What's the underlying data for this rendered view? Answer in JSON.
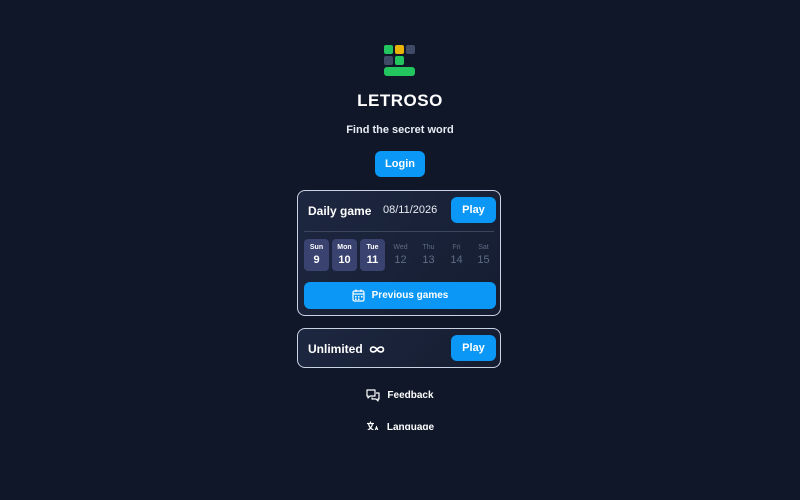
{
  "app": {
    "title": "LETROSO",
    "subtitle": "Find the secret word",
    "colors": {
      "background": "#0f1729",
      "accent": "#0a97f5",
      "green": "#22c55e",
      "yellow": "#eab308"
    }
  },
  "header": {
    "login_label": "Login",
    "logo_icon": "letroso-logo-icon"
  },
  "daily": {
    "label": "Daily game",
    "date": "08/11/2026",
    "play_label": "Play",
    "days": [
      {
        "name": "Sun",
        "num": "9",
        "state": "active"
      },
      {
        "name": "Mon",
        "num": "10",
        "state": "active"
      },
      {
        "name": "Tue",
        "num": "11",
        "state": "active"
      },
      {
        "name": "Wed",
        "num": "12",
        "state": "future"
      },
      {
        "name": "Thu",
        "num": "13",
        "state": "future"
      },
      {
        "name": "Fri",
        "num": "14",
        "state": "future"
      },
      {
        "name": "Sat",
        "num": "15",
        "state": "future"
      }
    ],
    "previous_label": "Previous games",
    "previous_icon": "calendar-icon"
  },
  "unlimited": {
    "label": "Unlimited",
    "icon": "infinity-icon",
    "play_label": "Play"
  },
  "links": {
    "feedback": {
      "label": "Feedback",
      "icon": "chat-bubbles-icon"
    },
    "language": {
      "label": "Language",
      "icon": "translate-icon"
    }
  }
}
